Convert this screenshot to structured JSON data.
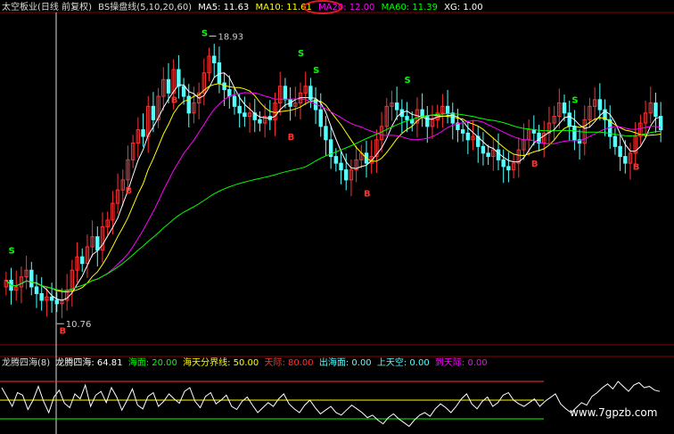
{
  "header": {
    "name": "太空板业(日线 前复权)",
    "indicator": "BS操盘线(5,10,20,60)",
    "ma5": "MA5: 11.63",
    "ma10": "MA10: 11.61",
    "ma20": "MA20: 12.00",
    "ma60": "MA60: 11.39",
    "xg": "XG: 1.00"
  },
  "sub_header": {
    "title": "龙腾四海(8)",
    "v_main": "龙腾四海: 64.81",
    "v_sea": "海面: 20.00",
    "v_line": "海天分界线: 50.00",
    "v_sky": "天际: 80.00",
    "v_out": "出海面: 0.00",
    "v_up": "上天空: 0.00",
    "v_arrive": "到天际: 0.00"
  },
  "colors": {
    "up": "#ff3232",
    "down": "#54ffff",
    "ma5": "#ffffff",
    "ma10": "#ffff00",
    "ma20": "#ff00ff",
    "ma60": "#00ff00",
    "grid": "#8b0000",
    "sig_s": "#00ff00",
    "sig_b": "#ff3232"
  },
  "watermark": "www.7gpzb.com",
  "chart_data": [
    {
      "type": "candlestick",
      "title": "太空板业(日线 前复权)",
      "ylim": [
        9.8,
        19.5
      ],
      "high_label": "18.93",
      "low_label": "10.76",
      "closes": [
        11.6,
        11.3,
        11.4,
        11.7,
        11.9,
        11.4,
        11.2,
        11.0,
        11.1,
        11.0,
        10.9,
        11.0,
        11.3,
        11.9,
        12.3,
        12.1,
        12.6,
        12.9,
        12.5,
        13.2,
        13.4,
        13.9,
        14.3,
        14.6,
        15.2,
        15.7,
        16.1,
        15.9,
        16.8,
        16.4,
        17.1,
        17.6,
        17.2,
        17.9,
        17.4,
        17.1,
        16.6,
        16.9,
        17.2,
        17.8,
        18.3,
        18.1,
        17.5,
        17.3,
        17.1,
        16.8,
        16.6,
        16.5,
        16.6,
        16.4,
        16.3,
        16.5,
        16.4,
        16.9,
        17.4,
        17.0,
        16.8,
        16.9,
        17.2,
        17.4,
        17.0,
        16.7,
        16.2,
        15.8,
        15.3,
        15.1,
        14.9,
        14.6,
        14.9,
        15.2,
        15.4,
        15.1,
        15.3,
        15.8,
        16.2,
        16.8,
        16.9,
        16.7,
        16.5,
        16.4,
        16.3,
        16.7,
        16.5,
        16.2,
        16.4,
        16.6,
        16.8,
        16.6,
        16.3,
        16.1,
        16.0,
        15.8,
        15.9,
        15.6,
        15.4,
        15.3,
        15.5,
        15.2,
        15.0,
        14.9,
        15.1,
        15.5,
        15.8,
        16.1,
        16.0,
        15.7,
        16.0,
        16.3,
        16.5,
        16.9,
        16.6,
        16.2,
        15.8,
        15.7,
        16.4,
        16.8,
        17.0,
        16.7,
        16.4,
        15.9,
        15.6,
        15.3,
        15.1,
        15.4,
        15.9,
        16.3,
        16.6,
        16.9,
        16.5,
        16.1
      ],
      "ma5_label": "MA5",
      "ma10_label": "MA10",
      "ma20_label": "MA20",
      "ma60_label": "MA60",
      "signals": [
        {
          "i": 1,
          "t": "S"
        },
        {
          "i": 11,
          "t": "B"
        },
        {
          "i": 24,
          "t": "B"
        },
        {
          "i": 39,
          "t": "S"
        },
        {
          "i": 33,
          "t": "B"
        },
        {
          "i": 56,
          "t": "B"
        },
        {
          "i": 58,
          "t": "S"
        },
        {
          "i": 61,
          "t": "S"
        },
        {
          "i": 71,
          "t": "B"
        },
        {
          "i": 79,
          "t": "S"
        },
        {
          "i": 104,
          "t": "B"
        },
        {
          "i": 112,
          "t": "S"
        },
        {
          "i": 124,
          "t": "B"
        }
      ]
    },
    {
      "type": "line",
      "title": "龙腾四海(8)",
      "ylim": [
        0,
        100
      ],
      "levels": [
        20,
        50,
        80
      ],
      "values": [
        70,
        55,
        40,
        62,
        58,
        35,
        50,
        72,
        48,
        30,
        55,
        66,
        45,
        38,
        60,
        52,
        74,
        40,
        58,
        64,
        46,
        70,
        55,
        34,
        50,
        68,
        42,
        36,
        56,
        62,
        40,
        48,
        60,
        52,
        45,
        64,
        70,
        48,
        38,
        56,
        62,
        44,
        50,
        58,
        40,
        35,
        48,
        55,
        42,
        30,
        38,
        46,
        40,
        52,
        60,
        44,
        36,
        30,
        42,
        50,
        38,
        28,
        34,
        40,
        30,
        26,
        34,
        42,
        36,
        30,
        22,
        26,
        18,
        12,
        22,
        28,
        20,
        14,
        8,
        18,
        26,
        30,
        24,
        36,
        44,
        38,
        30,
        40,
        52,
        60,
        44,
        36,
        48,
        55,
        40,
        46,
        58,
        62,
        50,
        44,
        40,
        46,
        52,
        40,
        48,
        54,
        60,
        44,
        36,
        30,
        38,
        46,
        42,
        56,
        62,
        70,
        76,
        68,
        80,
        72,
        64,
        74,
        78,
        70,
        72,
        66,
        64
      ]
    }
  ]
}
